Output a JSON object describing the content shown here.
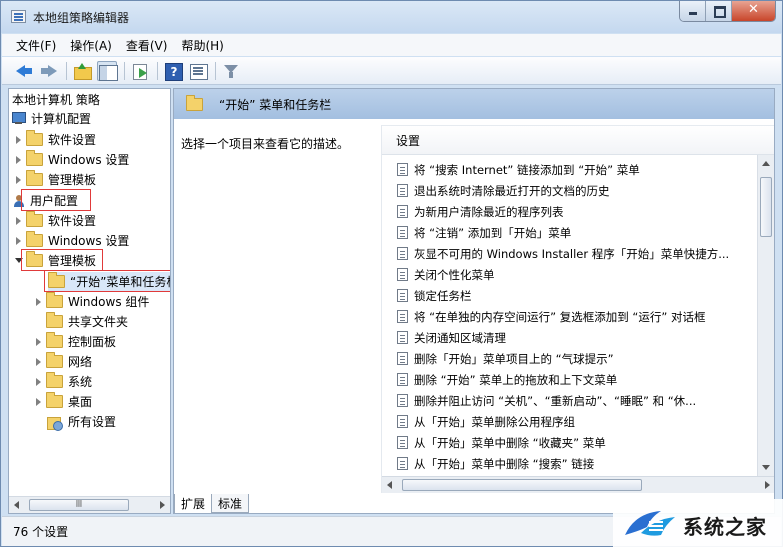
{
  "window": {
    "title": "本地组策略编辑器"
  },
  "menu": [
    "文件(F)",
    "操作(A)",
    "查看(V)",
    "帮助(H)"
  ],
  "tree": {
    "root": "本地计算机 策略",
    "computer_config": "计算机配置",
    "computer_children": [
      "软件设置",
      "Windows 设置",
      "管理模板"
    ],
    "user_config": "用户配置",
    "user_children": [
      "软件设置",
      "Windows 设置",
      "管理模板"
    ],
    "admin_children": [
      "“开始”菜单和任务栏",
      "Windows 组件",
      "共享文件夹",
      "控制面板",
      "网络",
      "系统",
      "桌面",
      "所有设置"
    ]
  },
  "right": {
    "header_title": "“开始” 菜单和任务栏",
    "description": "选择一个项目来查看它的描述。",
    "column_header": "设置",
    "settings": [
      "将 “搜索 Internet” 链接添加到 “开始” 菜单",
      "退出系统时清除最近打开的文档的历史",
      "为新用户清除最近的程序列表",
      "将 “注销” 添加到「开始」菜单",
      "灰显不可用的 Windows Installer 程序「开始」菜单快捷方...",
      "关闭个性化菜单",
      "锁定任务栏",
      "将 “在单独的内存空间运行” 复选框添加到 “运行” 对话框",
      "关闭通知区域清理",
      "删除「开始」菜单项目上的 “气球提示”",
      "删除 “开始” 菜单上的拖放和上下文菜单",
      "删除并阻止访问 “关机”、“重新启动”、“睡眠” 和 “休...",
      "从「开始」菜单删除公用程序组",
      "从「开始」菜单中删除 “收藏夹” 菜单",
      "从「开始」菜单中删除 “搜索” 链接"
    ],
    "tabs": [
      "扩展",
      "标准"
    ]
  },
  "status": {
    "text": "76 个设置"
  },
  "logo": {
    "text": "系统之家"
  }
}
